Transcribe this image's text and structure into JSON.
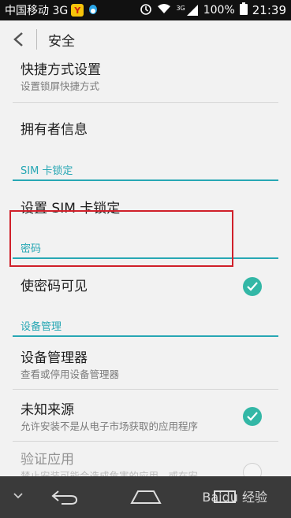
{
  "status_bar": {
    "carrier": "中国移动 3G",
    "network": "3G",
    "battery": "100%",
    "time": "21:39",
    "icons": [
      "app-icon-y",
      "qq-icon",
      "alarm-icon",
      "wifi-icon",
      "signal-icon",
      "battery-icon"
    ]
  },
  "header": {
    "title": "安全"
  },
  "items": {
    "shortcut": {
      "title": "快捷方式设置",
      "subtitle": "设置锁屏快捷方式"
    },
    "owner": {
      "title": "拥有者信息"
    },
    "sim_section": "SIM 卡锁定",
    "sim_lock": {
      "title": "设置 SIM 卡锁定"
    },
    "password_section": "密码",
    "show_password": {
      "title": "使密码可见",
      "checked": true
    },
    "device_section": "设备管理",
    "device_admin": {
      "title": "设备管理器",
      "subtitle": "查看或停用设备管理器"
    },
    "unknown_sources": {
      "title": "未知来源",
      "subtitle": "允许安装不是从电子市场获取的应用程序",
      "checked": true
    },
    "verify_apps": {
      "title": "验证应用",
      "subtitle": "禁止安装可能会造成危害的应用，或在安",
      "checked": false
    }
  },
  "watermark": "Baidu 经验",
  "colors": {
    "accent": "#27a7b4",
    "check": "#33b7a6",
    "highlight": "#d0202a"
  }
}
